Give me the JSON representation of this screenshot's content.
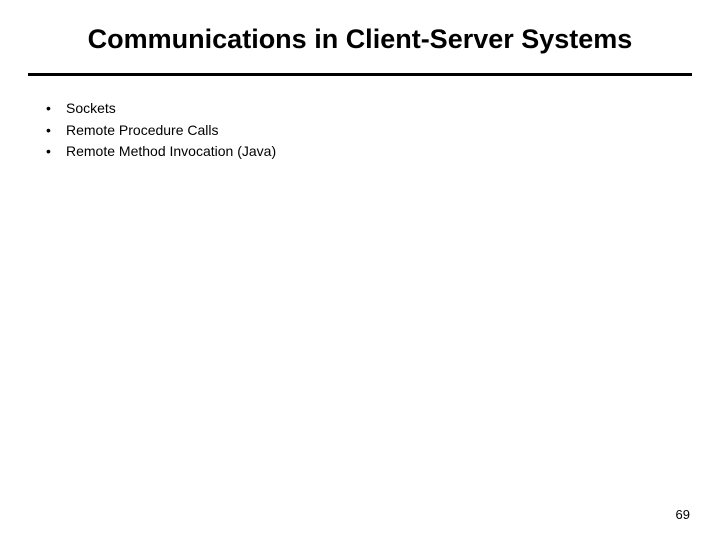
{
  "slide": {
    "title": "Communications in Client-Server Systems",
    "bullets": [
      "Sockets",
      "Remote Procedure Calls",
      "Remote Method Invocation (Java)"
    ],
    "page_number": "69"
  }
}
